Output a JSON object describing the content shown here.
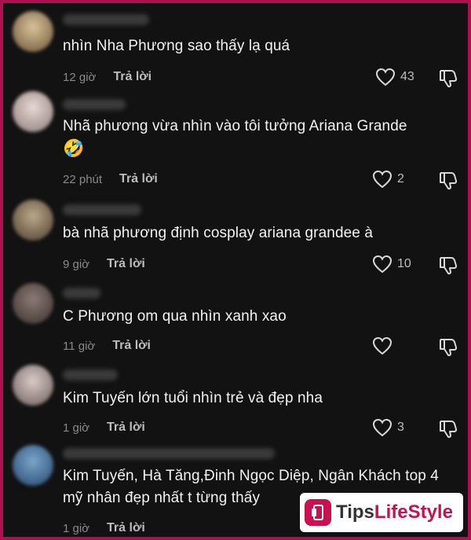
{
  "comments": [
    {
      "text": "nhìn Nha Phương sao thấy lạ quá",
      "time": "12 giờ",
      "reply": "Trả lời",
      "likes": "43",
      "avatar_color": "#8a6a4a"
    },
    {
      "text": "Nhã phương vừa nhìn vào tôi tưởng Ariana Grande",
      "emoji": "🤣",
      "time": "22 phút",
      "reply": "Trả lời",
      "likes": "2",
      "avatar_color": "#b9a7a4"
    },
    {
      "text": "bà nhã phương định cosplay ariana grandee à",
      "time": "9 giờ",
      "reply": "Trả lời",
      "likes": "10",
      "avatar_color": "#7a6a52"
    },
    {
      "text": "C Phương om qua nhìn xanh xao",
      "time": "11 giờ",
      "reply": "Trả lời",
      "likes": "",
      "avatar_color": "#5a4a44"
    },
    {
      "text": "Kim Tuyến lớn tuổi nhìn trẻ và đẹp nha",
      "time": "1 giờ",
      "reply": "Trả lời",
      "likes": "3",
      "avatar_color": "#a99a94"
    },
    {
      "text": "Kim Tuyến, Hà Tăng,Đinh Ngọc Diệp, Ngân Khách top 4 mỹ nhân đẹp nhất t từng thấy",
      "time": "1 giờ",
      "reply": "Trả lời",
      "likes": "",
      "avatar_color": "#3a6a9a"
    }
  ],
  "watermark": {
    "part1": "Tips",
    "part2": "LifeStyle"
  },
  "colors": {
    "background": "#121212",
    "border": "#b0104f",
    "accent": "#c8124f"
  }
}
